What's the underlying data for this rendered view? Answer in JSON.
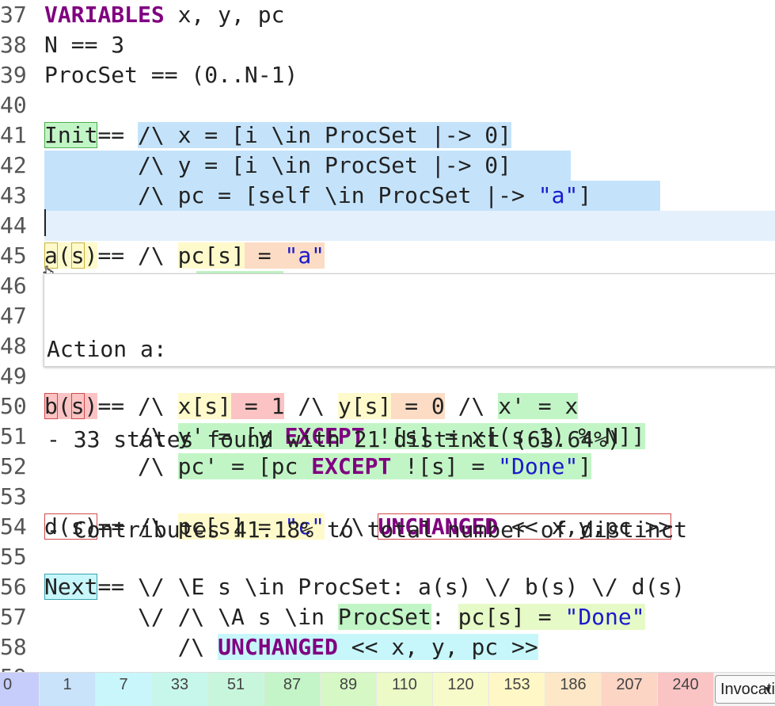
{
  "editor": {
    "lines": {
      "l37": {
        "num": "37",
        "kw": "VARIABLES",
        "rest": " x, y, pc"
      },
      "l38": {
        "num": "38",
        "text": "N == 3"
      },
      "l39": {
        "num": "39",
        "text": "ProcSet == (0..N-1)"
      },
      "l40": {
        "num": "40"
      },
      "l41": {
        "num": "41",
        "name": "Init",
        "op": "==",
        "space": " ",
        "body": "/\\ x = [i \\in ProcSet |-> 0]"
      },
      "l42": {
        "num": "42",
        "indent": "       ",
        "body": "/\\ y = [i \\in ProcSet |-> 0]"
      },
      "l43": {
        "num": "43",
        "indent": "       ",
        "body_a": "/\\ pc = [self \\in ProcSet |-> ",
        "str": "\"a\"",
        "body_b": "]"
      },
      "l44": {
        "num": "44"
      },
      "l45": {
        "num": "45",
        "a": "a",
        "lp": "(",
        "s": "s",
        "rp": ")",
        "op": "== /\\ ",
        "g1": "pc[s]",
        "g2": " = ",
        "str": "\"a\""
      },
      "l46": {
        "num": "46"
      },
      "l47": {
        "num": "47"
      },
      "l48": {
        "num": "48"
      },
      "l49": {
        "num": "49"
      },
      "l50": {
        "num": "50",
        "b": "b",
        "lp": "(",
        "s": "s",
        "rp": ")",
        "op": "== /\\ ",
        "x1": "x[s]",
        "x2": " = 1",
        "and1": " /\\ ",
        "y1": "y[s]",
        "y2": " = 0",
        "and2": " /\\ ",
        "x3": "x' = x"
      },
      "l51": {
        "num": "51",
        "indent": "       /\\ ",
        "p1": "y' = [y ",
        "kw": "EXCEPT",
        "p2": " ![s] = x[(s-1) % N]]"
      },
      "l52": {
        "num": "52",
        "indent": "       /\\ ",
        "p1": "pc' = [pc ",
        "kw": "EXCEPT",
        "p2": " ![s] = ",
        "str": "\"Done\"",
        "p3": "]"
      },
      "l53": {
        "num": "53"
      },
      "l54": {
        "num": "54",
        "name": "d(s)",
        "op": "== /\\ ",
        "y1": "pc[s] = ",
        "str": "\"c\"",
        "and": " /\\ ",
        "kw": "UNCHANGED",
        "rest": " << x,y,pc >>"
      },
      "l55": {
        "num": "55"
      },
      "l56": {
        "num": "56",
        "name": "Next",
        "rest": "== \\/ \\E s \\in ProcSet: a(s) \\/ b(s) \\/ d(s)"
      },
      "l57": {
        "num": "57",
        "indent": "       \\/ /\\ \\A s \\in ",
        "g1": "ProcSet",
        "colon": ": ",
        "g2a": "pc[s] = ",
        "str": "\"Done\"",
        "g2b": ""
      },
      "l58": {
        "num": "58",
        "indent": "          /\\ ",
        "kw": "UNCHANGED",
        "rest": " << x, y, pc >>"
      },
      "l59": {
        "num": "59"
      }
    }
  },
  "tooltip": {
    "line1": "Action a:",
    "line2": "- 33 states found with 21 distinct (63.64%)",
    "line3": "- Contributes 41.18% to total number of distinct"
  },
  "legend": {
    "values": [
      "0",
      "1",
      "7",
      "33",
      "51",
      "87",
      "89",
      "110",
      "120",
      "153",
      "186",
      "207",
      "240"
    ],
    "colors": [
      "#c6cdfb",
      "#c9e3fb",
      "#c9f6fb",
      "#c7f7ea",
      "#c8f6dd",
      "#c4f5c8",
      "#d6f8c4",
      "#ebfac7",
      "#f7fbc9",
      "#fff7c6",
      "#fde7c6",
      "#fcd5c4",
      "#fbc4c4"
    ],
    "dropdown_label": "Invocations"
  }
}
